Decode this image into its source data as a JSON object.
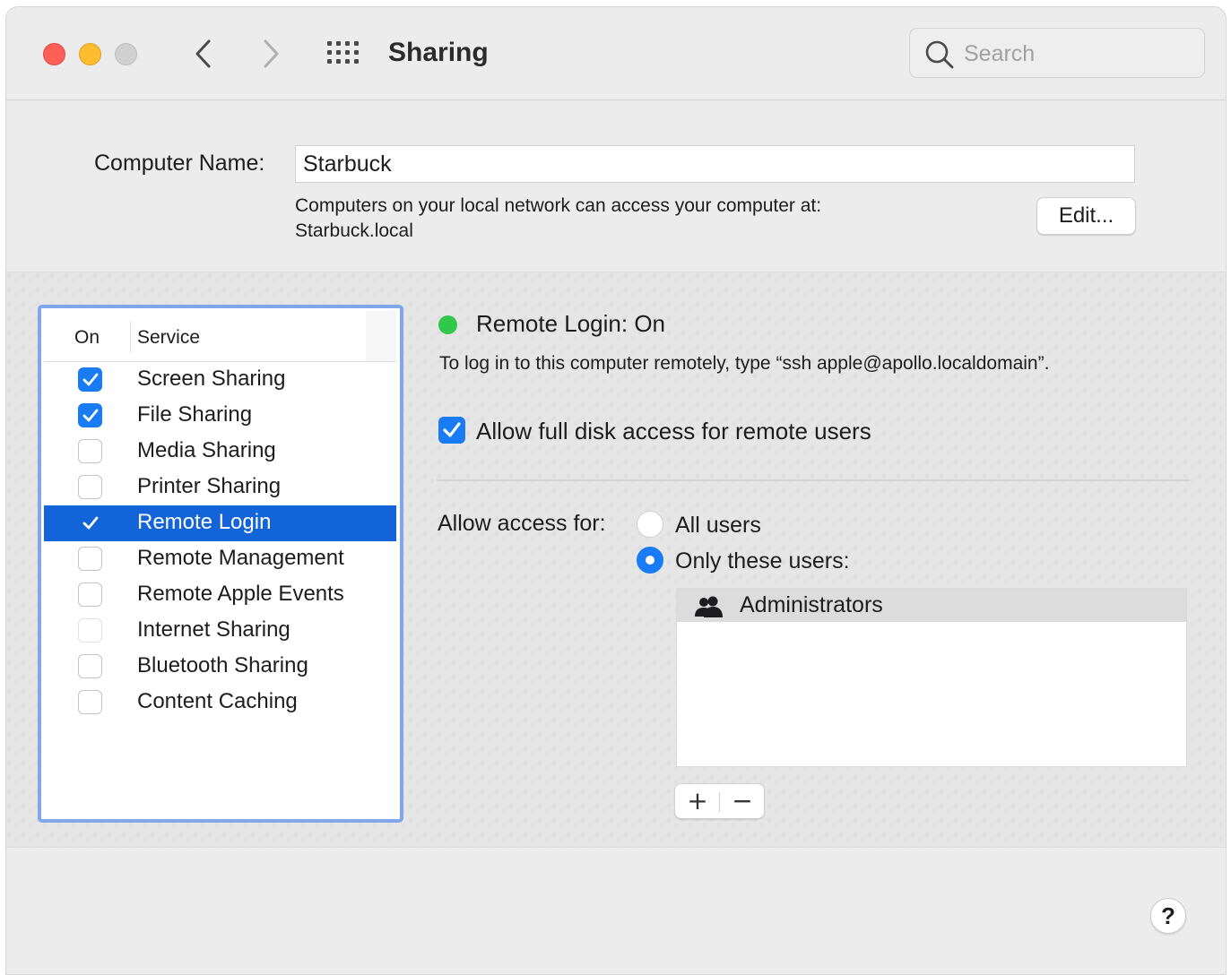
{
  "window": {
    "title": "Sharing",
    "search_placeholder": "Search"
  },
  "computer_name": {
    "label": "Computer Name:",
    "value": "Starbuck",
    "info_line1": "Computers on your local network can access your computer at:",
    "info_line2": "Starbuck.local",
    "edit_label": "Edit..."
  },
  "services": {
    "header_on": "On",
    "header_service": "Service",
    "items": [
      {
        "label": "Screen Sharing",
        "on": true
      },
      {
        "label": "File Sharing",
        "on": true
      },
      {
        "label": "Media Sharing",
        "on": false
      },
      {
        "label": "Printer Sharing",
        "on": false
      },
      {
        "label": "Remote Login",
        "on": true,
        "selected": true
      },
      {
        "label": "Remote Management",
        "on": false
      },
      {
        "label": "Remote Apple Events",
        "on": false
      },
      {
        "label": "Internet Sharing",
        "on": false,
        "disabled": true
      },
      {
        "label": "Bluetooth Sharing",
        "on": false
      },
      {
        "label": "Content Caching",
        "on": false
      }
    ]
  },
  "detail": {
    "status": "Remote Login: On",
    "status_color": "#2fc84a",
    "hint": "To log in to this computer remotely, type “ssh apple@apollo.localdomain”.",
    "full_disk_label": "Allow full disk access for remote users",
    "full_disk_checked": true,
    "access_label": "Allow access for:",
    "option_all": "All users",
    "option_only": "Only these users:",
    "selected_option": "Only these users:",
    "users": [
      "Administrators"
    ],
    "add_label": "+",
    "remove_label": "−"
  },
  "help_label": "?",
  "colors": {
    "accent": "#1a7cf5",
    "selection": "#1363d9",
    "focus_ring": "#7fa7ea"
  }
}
